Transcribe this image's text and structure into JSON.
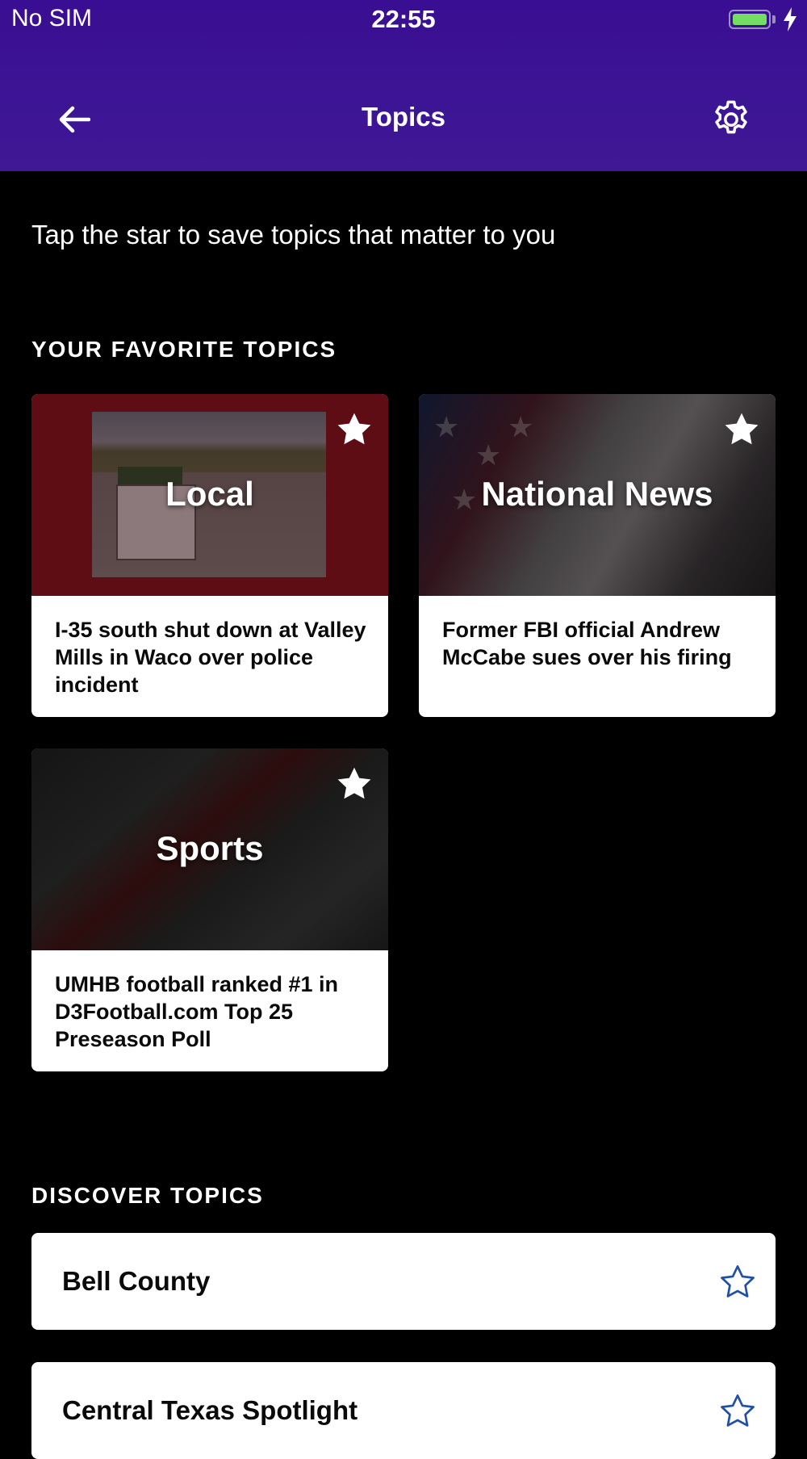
{
  "status_bar": {
    "carrier": "No SIM",
    "time": "22:55",
    "battery_level": 1.0,
    "charging": true
  },
  "header": {
    "title": "Topics",
    "back_icon": "arrow-left-icon",
    "settings_icon": "gear-icon"
  },
  "intro_text": "Tap the star to save topics that matter to you",
  "favorites": {
    "heading": "YOUR FAVORITE TOPICS",
    "cards": [
      {
        "topic": "Local",
        "headline": "I-35 south shut down at Valley Mills in Waco over police incident",
        "starred": true
      },
      {
        "topic": "National News",
        "headline": "Former FBI official Andrew McCabe sues over his firing",
        "starred": true
      },
      {
        "topic": "Sports",
        "headline": "UMHB football ranked #1 in D3Football.com Top 25 Preseason Poll",
        "starred": true
      }
    ]
  },
  "discover": {
    "heading": "DISCOVER TOPICS",
    "items": [
      {
        "label": "Bell County",
        "starred": false
      },
      {
        "label": "Central Texas Spotlight",
        "starred": false
      }
    ]
  },
  "colors": {
    "header_bg": "#3c1595",
    "page_bg": "#000000",
    "star_outline": "#1f4fa8",
    "battery": "#74dd63"
  }
}
